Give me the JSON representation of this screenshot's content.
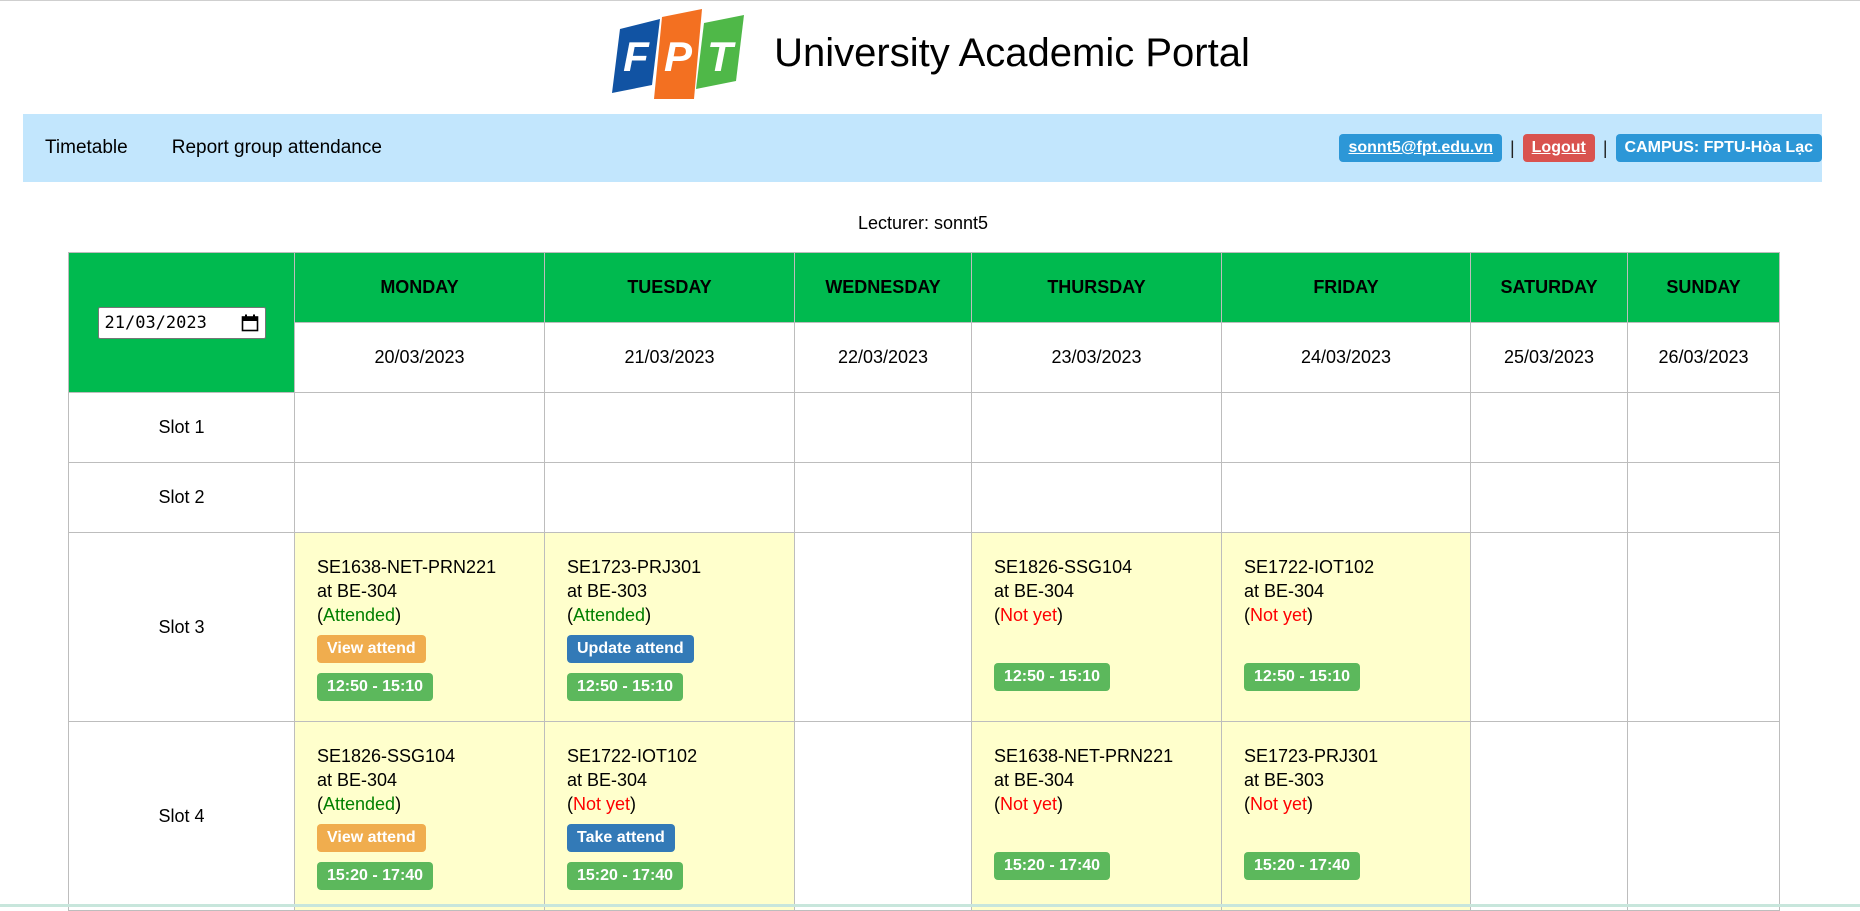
{
  "header": {
    "logo_letters": [
      "F",
      "P",
      "T"
    ],
    "logo_colors": [
      "#1153a3",
      "#f37021",
      "#4fb848"
    ],
    "title": "University Academic Portal"
  },
  "nav": {
    "links": [
      "Timetable",
      "Report group attendance"
    ],
    "user_email": "sonnt5@fpt.edu.vn",
    "separator": "|",
    "logout": "Logout",
    "campus": "CAMPUS: FPTU-Hòa Lạc"
  },
  "lecturer_line": "Lecturer: sonnt5",
  "timetable": {
    "selected_date": "21/03/2023",
    "days": [
      "MONDAY",
      "TUESDAY",
      "WEDNESDAY",
      "THURSDAY",
      "FRIDAY",
      "SATURDAY",
      "SUNDAY"
    ],
    "dates": [
      "20/03/2023",
      "21/03/2023",
      "22/03/2023",
      "23/03/2023",
      "24/03/2023",
      "25/03/2023",
      "26/03/2023"
    ],
    "slots": [
      {
        "label": "Slot 1"
      },
      {
        "label": "Slot 2"
      },
      {
        "label": "Slot 3",
        "cells": {
          "mon": {
            "course": "SE1638-NET-PRN221",
            "room": "at BE-304",
            "open": "(",
            "status": "Attended",
            "close": ")",
            "action": "View attend",
            "time": "12:50 - 15:10"
          },
          "tue": {
            "course": "SE1723-PRJ301",
            "room": "at BE-303",
            "open": "(",
            "status": "Attended",
            "close": ")",
            "action": "Update attend",
            "time": "12:50 - 15:10"
          },
          "thu": {
            "course": "SE1826-SSG104",
            "room": "at BE-304",
            "open": "(",
            "status": "Not yet",
            "close": ")",
            "time": "12:50 - 15:10"
          },
          "fri": {
            "course": "SE1722-IOT102",
            "room": "at BE-304",
            "open": "(",
            "status": "Not yet",
            "close": ")",
            "time": "12:50 - 15:10"
          }
        }
      },
      {
        "label": "Slot 4",
        "cells": {
          "mon": {
            "course": "SE1826-SSG104",
            "room": "at BE-304",
            "open": "(",
            "status": "Attended",
            "close": ")",
            "action": "View attend",
            "time": "15:20 - 17:40"
          },
          "tue": {
            "course": "SE1722-IOT102",
            "room": "at BE-304",
            "open": "(",
            "status": "Not yet",
            "close": ")",
            "action": "Take attend",
            "time": "15:20 - 17:40"
          },
          "thu": {
            "course": "SE1638-NET-PRN221",
            "room": "at BE-304",
            "open": "(",
            "status": "Not yet",
            "close": ")",
            "time": "15:20 - 17:40"
          },
          "fri": {
            "course": "SE1723-PRJ301",
            "room": "at BE-303",
            "open": "(",
            "status": "Not yet",
            "close": ")",
            "time": "15:20 - 17:40"
          }
        }
      }
    ]
  },
  "colors": {
    "nav_bg": "#c2e6fd",
    "header_green": "#00ba4f",
    "cell_yellow": "#ffffcc",
    "attended": "#008000",
    "not_yet": "#ff0000",
    "time_badge": "#5cb85c",
    "view_btn": "#f0ad4e",
    "action_btn": "#337ab7",
    "logout_btn": "#d9534f",
    "info_btn": "#2c97d7"
  }
}
